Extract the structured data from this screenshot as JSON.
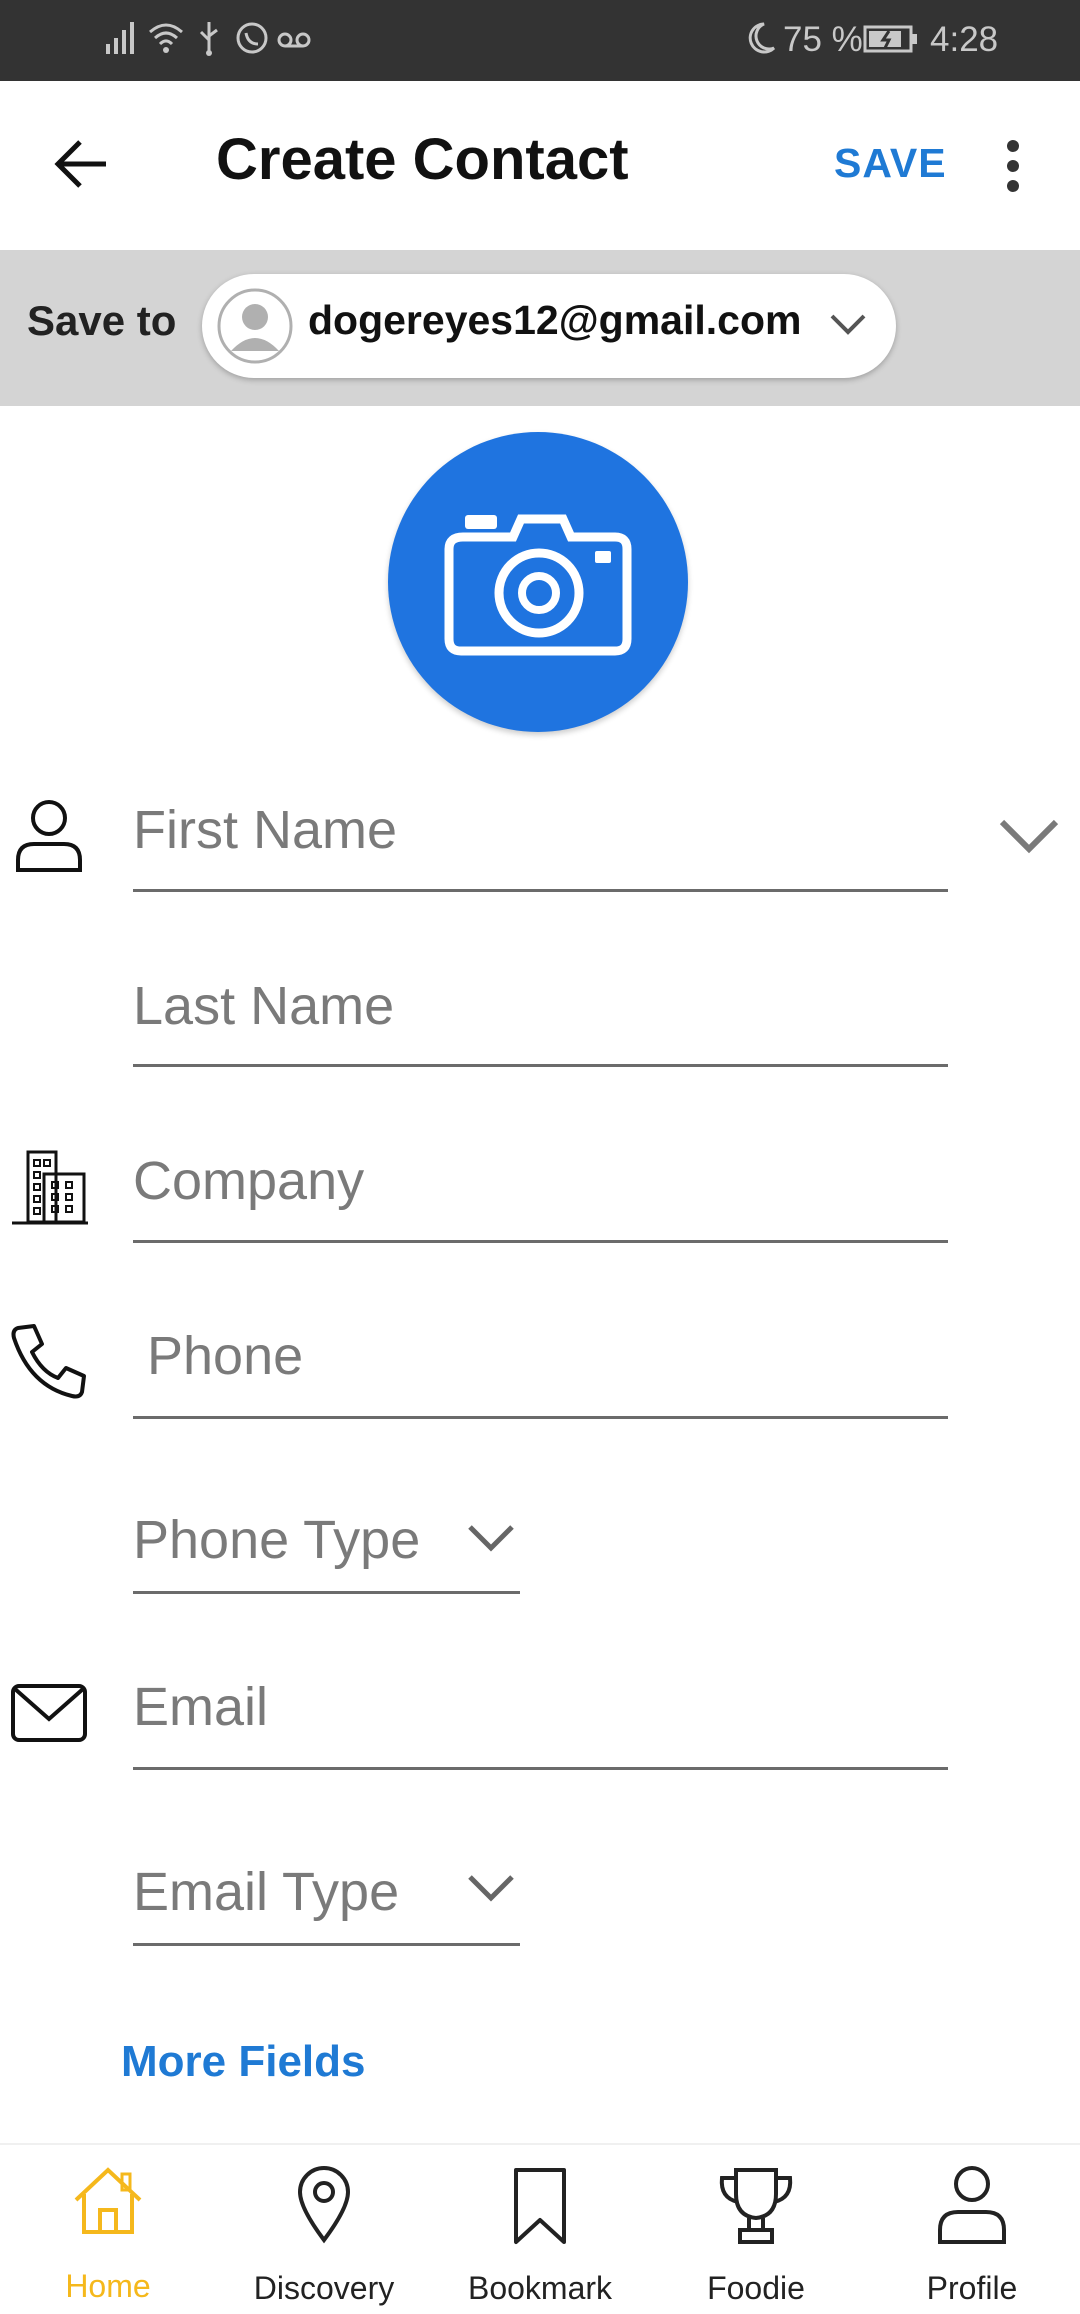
{
  "status_bar": {
    "battery": "75 %",
    "time": "4:28"
  },
  "app_bar": {
    "title": "Create Contact",
    "save_label": "SAVE"
  },
  "save_to": {
    "label": "Save to",
    "account_email": "dogereyes12@gmail.com"
  },
  "form": {
    "first_name": "First Name",
    "last_name": "Last Name",
    "company": "Company",
    "phone": "Phone",
    "phone_type": "Phone Type",
    "email": "Email",
    "email_type": "Email Type",
    "more_fields": "More Fields"
  },
  "bottom_nav": {
    "items": [
      {
        "label": "Home",
        "icon": "home-icon",
        "active": true
      },
      {
        "label": "Discovery",
        "icon": "location-pin-icon",
        "active": false
      },
      {
        "label": "Bookmark",
        "icon": "bookmark-icon",
        "active": false
      },
      {
        "label": "Foodie",
        "icon": "trophy-icon",
        "active": false
      },
      {
        "label": "Profile",
        "icon": "profile-icon",
        "active": false
      }
    ]
  },
  "colors": {
    "accent": "#1f7ad4",
    "camera_circle": "#1f74e0",
    "nav_active": "#f5b81c",
    "status_bar": "#333333",
    "save_to_bar": "#d4d4d4"
  }
}
